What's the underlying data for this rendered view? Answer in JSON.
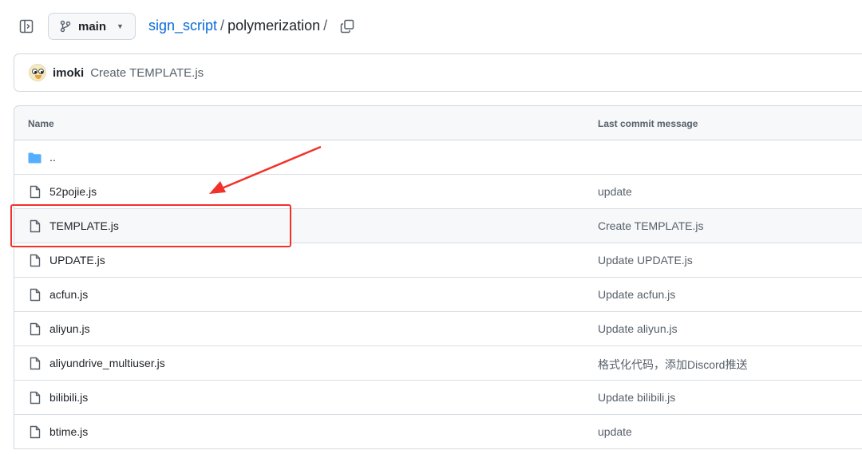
{
  "header": {
    "branch": "main",
    "repo": "sign_script",
    "sep": "/",
    "dir": "polymerization",
    "trailing_sep": "/"
  },
  "commit": {
    "author": "imoki",
    "message": "Create TEMPLATE.js"
  },
  "table": {
    "col_name": "Name",
    "col_message": "Last commit message",
    "parent_dir": "..",
    "rows": [
      {
        "name": "52pojie.js",
        "message": "update"
      },
      {
        "name": "TEMPLATE.js",
        "message": "Create TEMPLATE.js"
      },
      {
        "name": "UPDATE.js",
        "message": "Update UPDATE.js"
      },
      {
        "name": "acfun.js",
        "message": "Update acfun.js"
      },
      {
        "name": "aliyun.js",
        "message": "Update aliyun.js"
      },
      {
        "name": "aliyundrive_multiuser.js",
        "message": "格式化代码，添加Discord推送"
      },
      {
        "name": "bilibili.js",
        "message": "Update bilibili.js"
      },
      {
        "name": "btime.js",
        "message": "update"
      }
    ]
  },
  "colors": {
    "link": "#0969da",
    "folder": "#54aeff",
    "annotation": "#f2312a"
  }
}
